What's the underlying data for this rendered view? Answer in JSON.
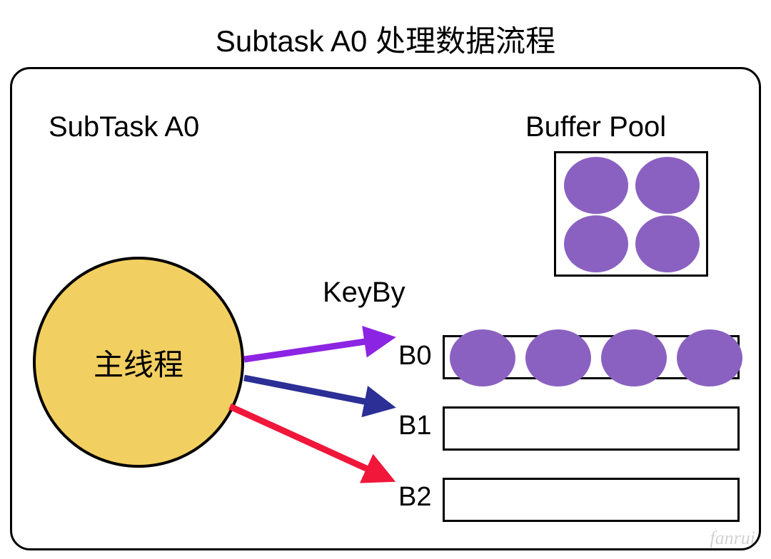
{
  "title": "Subtask A0 处理数据流程",
  "labels": {
    "subtask": "SubTask A0",
    "bufferpool": "Buffer Pool",
    "keyby": "KeyBy",
    "circle": "主线程"
  },
  "queues": {
    "b0": "B0",
    "b1": "B1",
    "b2": "B2"
  },
  "colors": {
    "circle_fill": "#f2cf61",
    "oval_fill": "#8a61c1",
    "arrow_purple": "#8c24e3",
    "arrow_blue": "#2b2f96",
    "arrow_red": "#f0173b"
  },
  "watermark": "fanrui"
}
